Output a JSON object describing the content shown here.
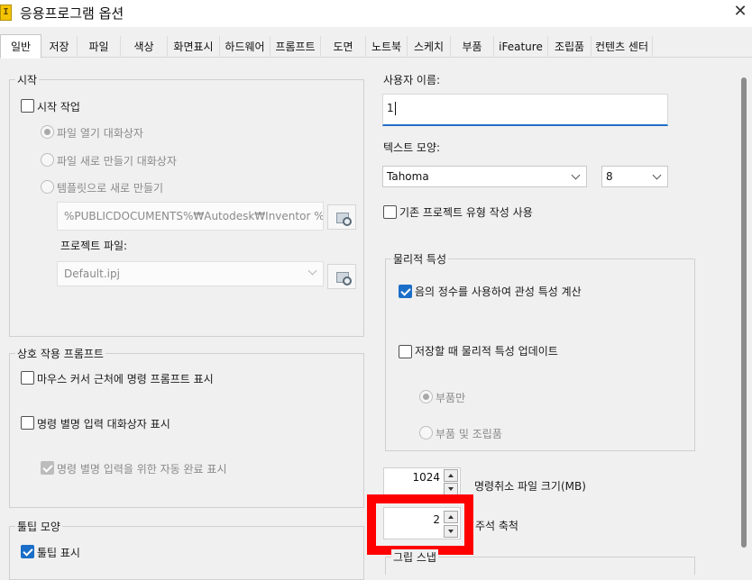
{
  "window": {
    "title": "응용프로그램 옵션",
    "app_icon": "inventor-app-icon",
    "close_glyph": "✕"
  },
  "tabs": [
    {
      "label": "일반",
      "active": true
    },
    {
      "label": "저장"
    },
    {
      "label": "파일"
    },
    {
      "label": "색상"
    },
    {
      "label": "화면표시"
    },
    {
      "label": "하드웨어"
    },
    {
      "label": "프롬프트"
    },
    {
      "label": "도면"
    },
    {
      "label": "노트북"
    },
    {
      "label": "스케치"
    },
    {
      "label": "부품"
    },
    {
      "label": "iFeature"
    },
    {
      "label": "조립품"
    },
    {
      "label": "컨텐츠 센터"
    }
  ],
  "startup": {
    "group_title": "시작",
    "startup_action_label": "시작 작업",
    "startup_action_checked": false,
    "radio_open": "파일 열기 대화상자",
    "radio_new": "파일 새로 만들기 대화상자",
    "radio_template": "템플릿으로 새로 만들기",
    "selected_radio": "파일 열기 대화상자",
    "template_path": "%PUBLICDOCUMENTS%₩Autodesk₩Inventor %F",
    "project_label": "프로젝트 파일:",
    "project_value": "Default.ipj"
  },
  "interactive_prompts": {
    "group_title": "상호 작용 프롬프트",
    "show_near_cursor": "마우스 커서 근처에 명령 프롬프트 표시",
    "show_near_cursor_checked": false,
    "show_alias_dialog": "명령 별명 입력 대화상자 표시",
    "show_alias_dialog_checked": false,
    "alias_autocomplete": "명령 별명 입력을 위한 자동 완료 표시",
    "alias_autocomplete_checked": true
  },
  "tooltip": {
    "group_title": "툴팁 모양",
    "show_tooltip": "툴팁 표시",
    "show_tooltip_checked": true
  },
  "right": {
    "username_label": "사용자 이름:",
    "username_value": "1",
    "text_style_label": "텍스트 모양:",
    "font_value": "Tahoma",
    "font_size_value": "8",
    "legacy_project_label": "기존 프로젝트 유형 작성 사용",
    "legacy_project_checked": false
  },
  "physical": {
    "group_title": "물리적 특성",
    "negative_integer_label": "음의 정수를 사용하여 관성 특성 계산",
    "negative_integer_checked": true,
    "update_on_save_label": "저장할 때 물리적 특성 업데이트",
    "update_on_save_checked": false,
    "radio_parts_only": "부품만",
    "radio_parts_assemblies": "부품 및 조립품",
    "selected_radio": "부품만"
  },
  "undo": {
    "value": "1024",
    "label": "명령취소 파일 크기(MB)"
  },
  "annotation_scale": {
    "value": "2",
    "label": "주석 축척"
  },
  "grip_snap": {
    "group_title": "그립 스냅"
  },
  "colors": {
    "accent": "#1a6ec8",
    "highlight": "#ff0000"
  }
}
